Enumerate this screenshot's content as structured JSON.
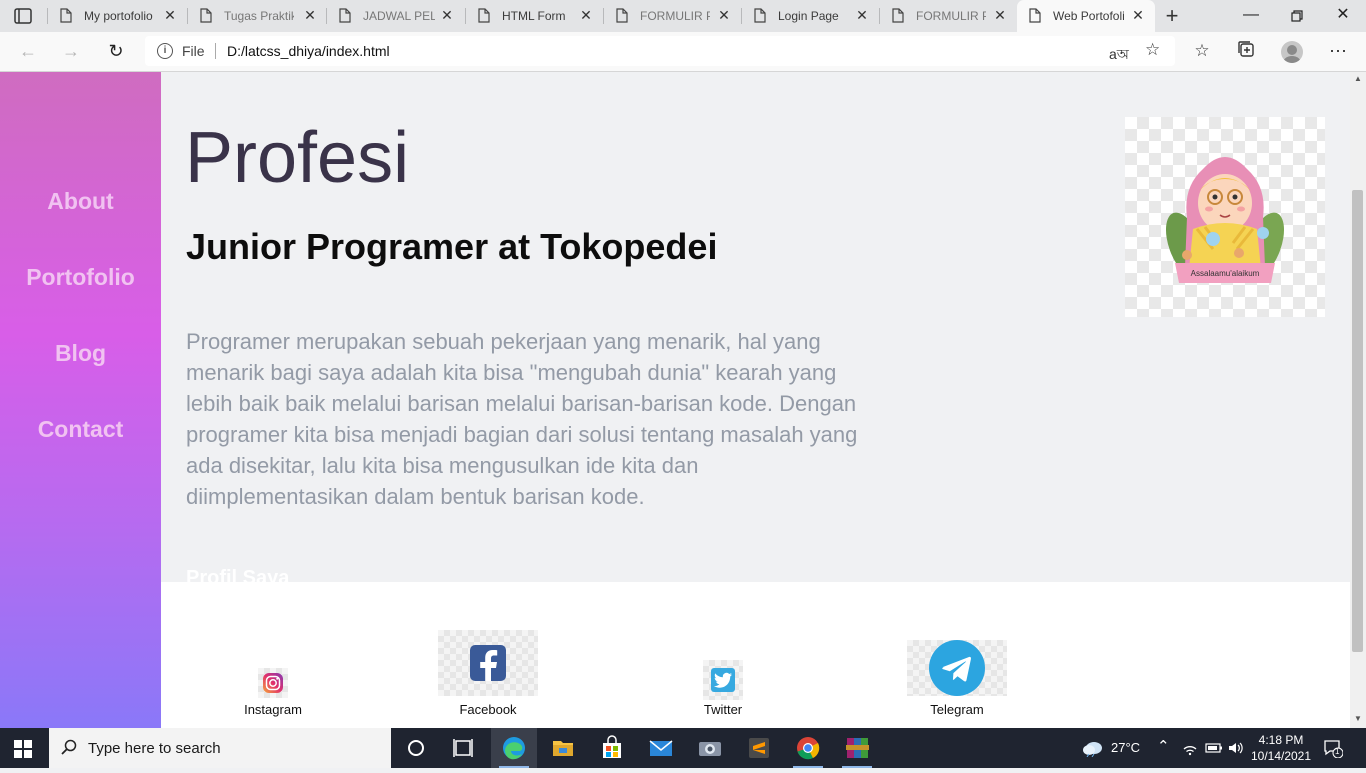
{
  "browser": {
    "tabs": [
      {
        "label": "My portofolio",
        "active": false
      },
      {
        "label": "Tugas Praktik",
        "active": false
      },
      {
        "label": "JADWAL PELA",
        "active": false
      },
      {
        "label": "HTML Form",
        "active": false
      },
      {
        "label": "FORMULIR PE",
        "active": false
      },
      {
        "label": "Login Page",
        "active": false
      },
      {
        "label": "FORMULIR PE",
        "active": false
      },
      {
        "label": "Web Portofoli",
        "active": true
      }
    ],
    "address": {
      "scheme": "File",
      "url": "D:/latcss_dhiya/index.html"
    }
  },
  "page": {
    "nav": [
      "About",
      "Portofolio",
      "Blog",
      "Contact"
    ],
    "title": "Profesi",
    "subtitle": "Junior Programer at Tokopedei",
    "paragraph": "Programer merupakan sebuah pekerjaan yang menarik, hal yang menarik bagi saya adalah kita bisa \"mengubah dunia\" kearah yang lebih baik baik melalui barisan melalui barisan-barisan kode. Dengan programer kita bisa menjadi bagian dari solusi tentang masalah yang ada disekitar, lalu kita bisa mengusulkan ide kita dan diimplementasikan dalam bentuk barisan kode.",
    "section_heading": "Profil Saya",
    "hero_caption": "Assalaamu'alaikum",
    "social": [
      {
        "label": "Instagram",
        "icon": "instagram-icon"
      },
      {
        "label": "Facebook",
        "icon": "facebook-icon"
      },
      {
        "label": "Twitter",
        "icon": "twitter-icon"
      },
      {
        "label": "Telegram",
        "icon": "telegram-icon"
      }
    ]
  },
  "taskbar": {
    "search_placeholder": "Type here to search",
    "weather": "27°C",
    "time": "4:18 PM",
    "date": "10/14/2021",
    "notifications": "1"
  },
  "colors": {
    "sidebar_top": "#cf6cc0",
    "sidebar_bottom": "#8a78f8",
    "title": "#3a3349",
    "paragraph": "#939aa6"
  }
}
